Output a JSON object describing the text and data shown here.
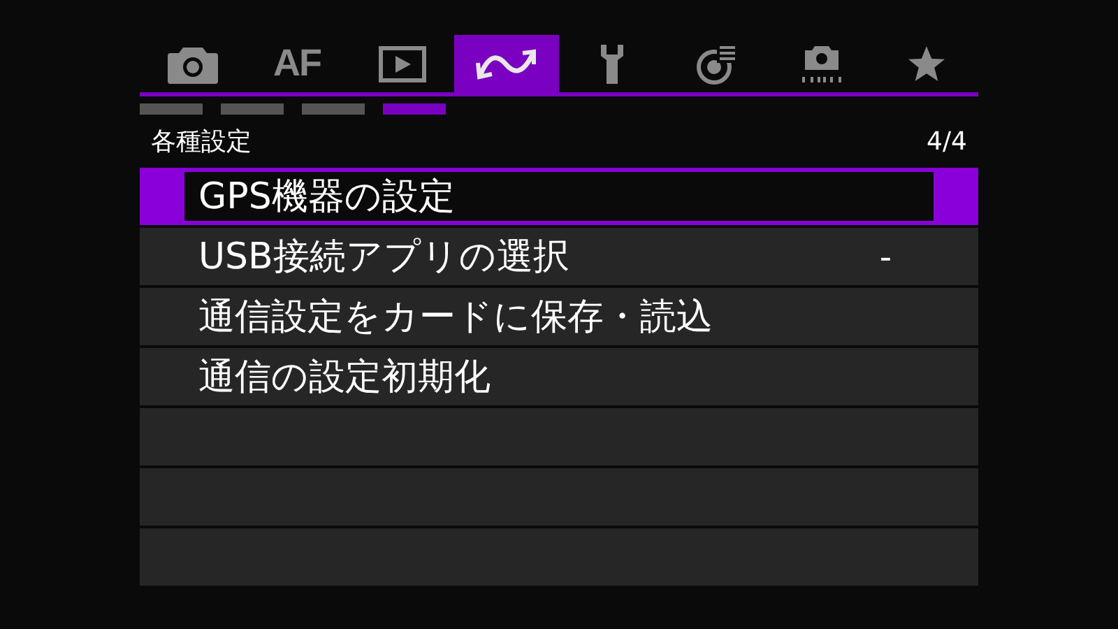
{
  "tabs": [
    {
      "kind": "camera",
      "selected": false
    },
    {
      "kind": "text",
      "label": "AF",
      "selected": false
    },
    {
      "kind": "play",
      "selected": false
    },
    {
      "kind": "wireless",
      "selected": true
    },
    {
      "kind": "wrench",
      "selected": false
    },
    {
      "kind": "custom",
      "selected": false
    },
    {
      "kind": "camera-dots",
      "selected": false
    },
    {
      "kind": "star",
      "selected": false
    }
  ],
  "pages": [
    {
      "selected": false
    },
    {
      "selected": false
    },
    {
      "selected": false
    },
    {
      "selected": true
    }
  ],
  "section": {
    "title": "各種設定",
    "page": "4/4"
  },
  "items": [
    {
      "label": "GPS機器の設定",
      "selected": true
    },
    {
      "label": "USB接続アプリの選択",
      "value": "-",
      "selected": false
    },
    {
      "label": "通信設定をカードに保存・読込",
      "selected": false
    },
    {
      "label": "通信の設定初期化",
      "selected": false
    }
  ]
}
